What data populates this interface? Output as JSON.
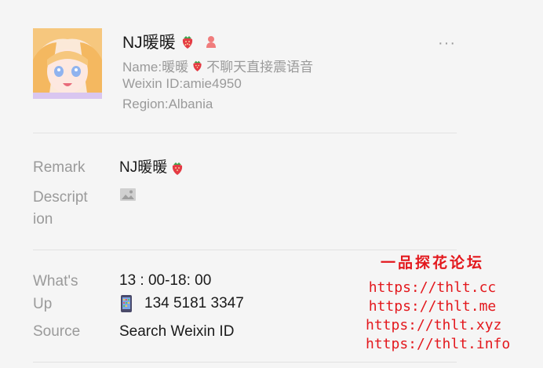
{
  "contact": {
    "display_name": "NJ暖暖",
    "name_line": "Name:暖暖",
    "name_suffix": "不聊天直接震语音",
    "weixin_id": "Weixin ID:amie4950",
    "region": "Region:Albania"
  },
  "menu": {
    "more_label": "···"
  },
  "details": {
    "remark_label": "Remark",
    "remark_value": "NJ暖暖",
    "description_label": "Descript\nion",
    "whatsup_label": "What's\nUp",
    "whatsup_line1": "13 : 00-18:  00",
    "whatsup_line2": "134 5181 3347",
    "source_label": "Source",
    "source_value": "Search Weixin ID"
  },
  "watermark": {
    "title": "一品探花论坛",
    "urls": [
      "https://thlt.cc",
      "https://thlt.me",
      "https://thlt.xyz",
      "https://thlt.info"
    ]
  },
  "colors": {
    "watermark": "#e3181d",
    "muted": "#9a9a9a",
    "text": "#1a1a1a"
  }
}
